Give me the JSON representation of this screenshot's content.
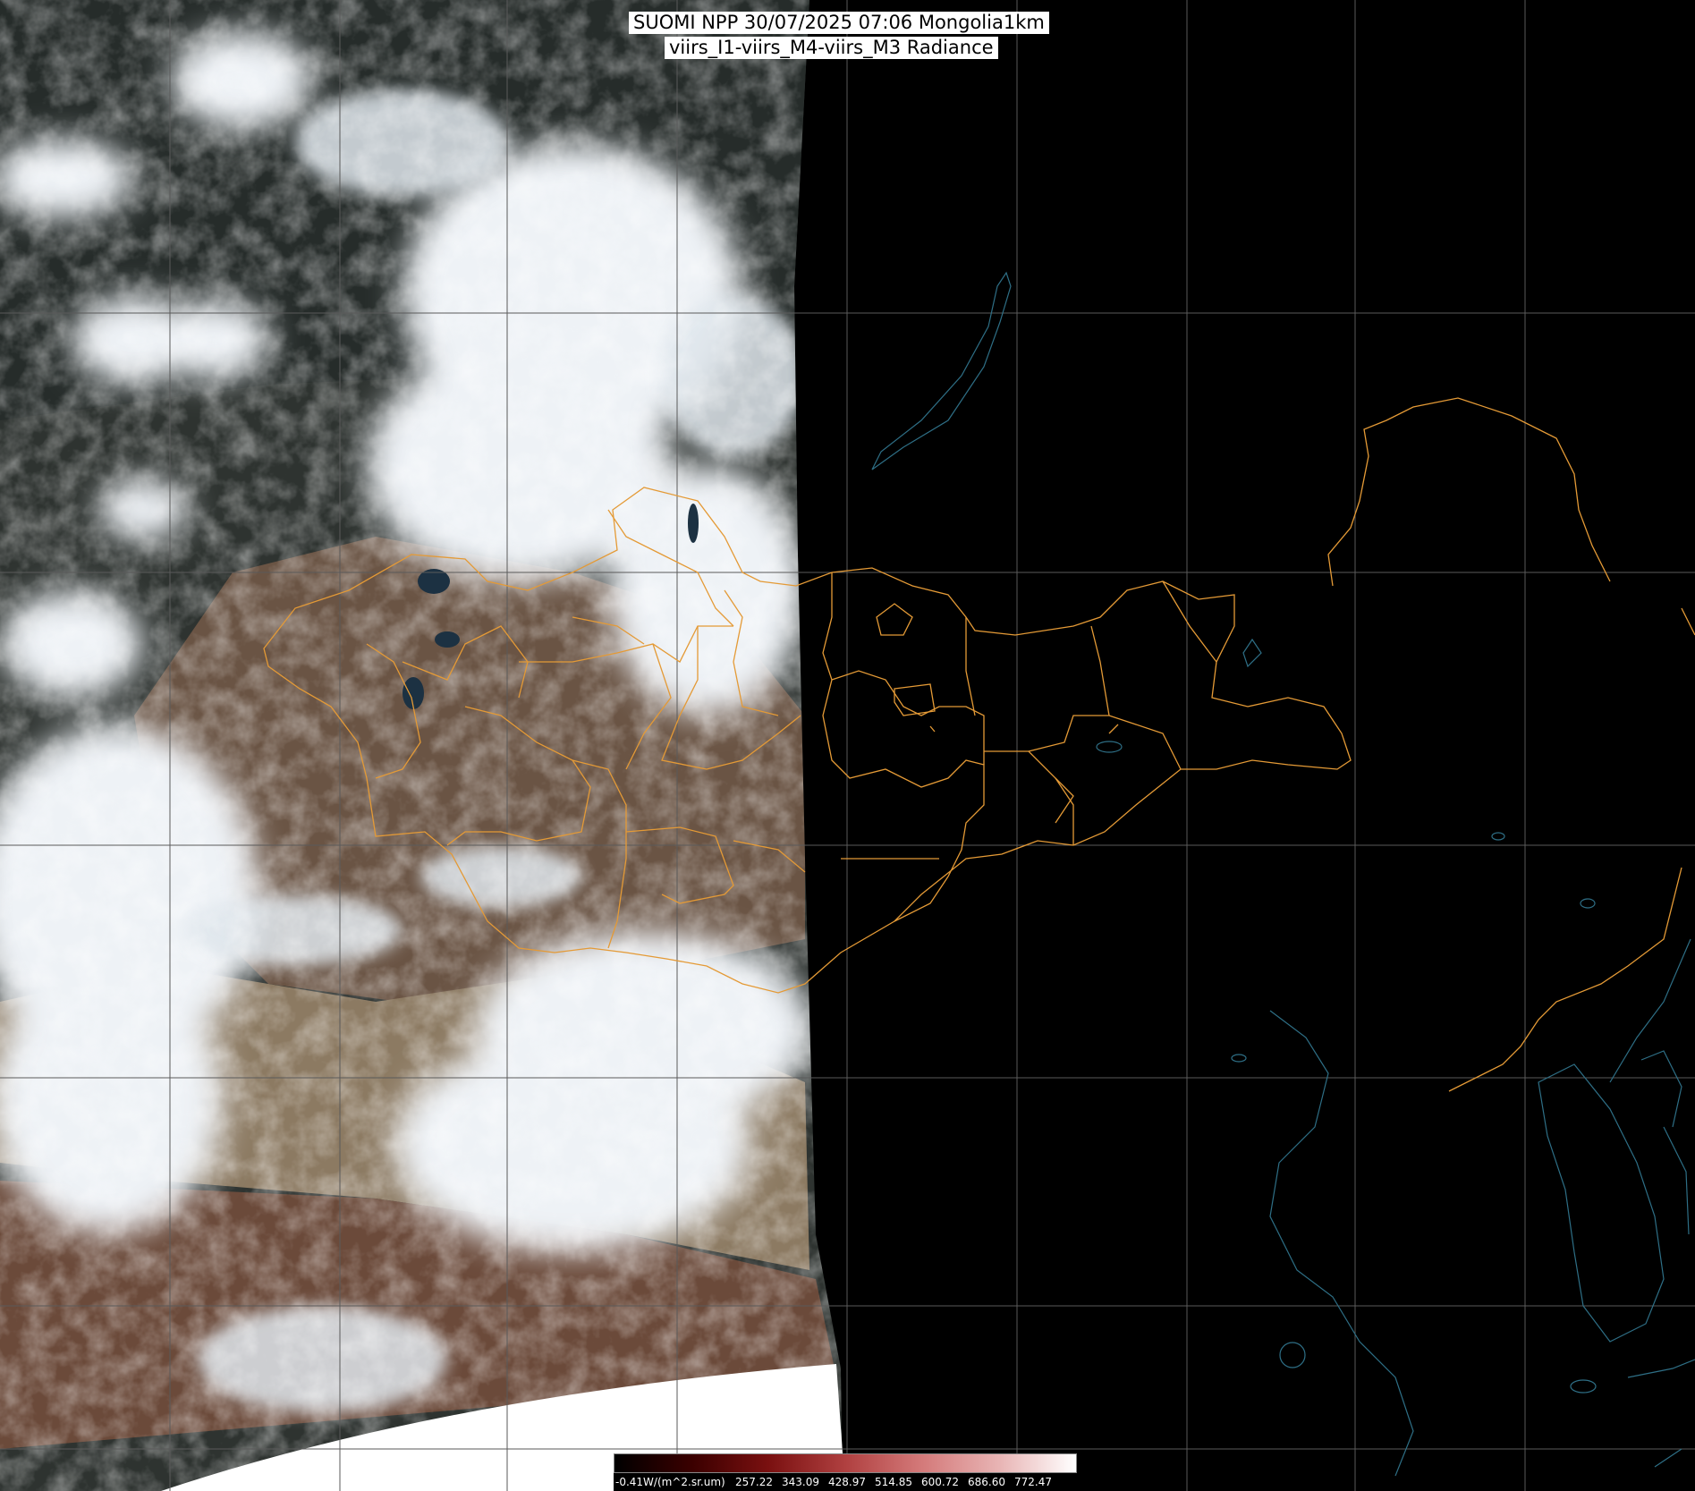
{
  "header": {
    "line1": "SUOMI NPP 30/07/2025 07:06 Mongolia1km",
    "line2": "viirs_I1-viirs_M4-viirs_M3 Radiance"
  },
  "colorbar": {
    "unit_label": "-0.41W/(m^2.sr.um)",
    "ticks": [
      "257.22",
      "343.09",
      "428.97",
      "514.85",
      "600.72",
      "686.60",
      "772.47"
    ],
    "colors": [
      "#000000",
      "#3a0000",
      "#7a1010",
      "#b04040",
      "#d47a7a",
      "#e8b4b4",
      "#ffffff"
    ]
  },
  "map": {
    "colors": {
      "background": "#000000",
      "graticule": "#5a5a5a",
      "admin_border": "#e49a36",
      "coastline": "#2e6f86",
      "cloud": "#eef2f6",
      "land_dark": "#2e3330",
      "desert": "#8c7a62",
      "steppe": "#6a5444"
    }
  }
}
